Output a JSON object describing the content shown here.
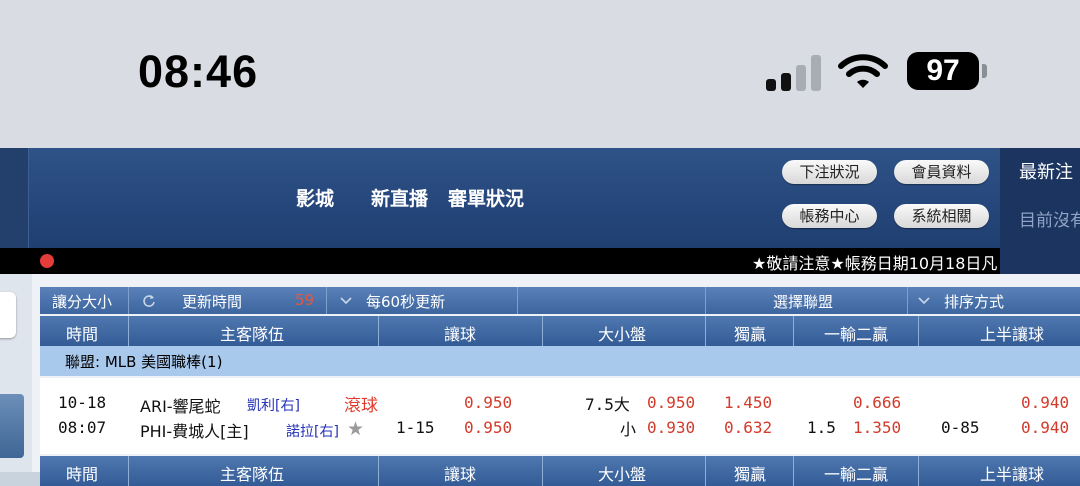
{
  "status_bar": {
    "time": "08:46",
    "battery": "97"
  },
  "header": {
    "nav": [
      "影城",
      "新直播",
      "審單狀況"
    ],
    "buttons": [
      "下注狀況",
      "會員資料",
      "帳務中心",
      "系統相關"
    ],
    "notice_title": "最新注",
    "notice_text": "目前沒有"
  },
  "ticker": {
    "text": "★敬請注意★帳務日期10月18日凡"
  },
  "toolbar": {
    "handicap_toggle": "讓分大小",
    "refresh_label": "更新時間",
    "countdown": "59",
    "refresh_interval": "每60秒更新",
    "select_league": "選擇聯盟",
    "sort_label": "排序方式"
  },
  "table": {
    "columns": [
      "時間",
      "主客隊伍",
      "讓球",
      "大小盤",
      "獨贏",
      "一輸二贏",
      "上半讓球"
    ],
    "league": "聯盟: MLB 美國職棒(1)",
    "match": {
      "date": "10-18",
      "time": "08:07",
      "team_away": "ARI-響尾蛇",
      "pitcher_away": "凱利[右]",
      "live_label": "滾球",
      "team_home": "PHI-費城人[主]",
      "pitcher_home": "諾拉[右]",
      "handicap_line": "1-15",
      "handicap_odds_away": "0.950",
      "handicap_odds_home": "0.950",
      "ou_over_line": "7.5大",
      "ou_over_odds": "0.950",
      "ou_under_label": "小",
      "ou_under_odds": "0.930",
      "moneyline_away": "1.450",
      "moneyline_home": "0.632",
      "one_lose_two_win_away": "0.666",
      "one_lose_two_win_line": "1.5",
      "one_lose_two_win_home": "1.350",
      "first_half_line": "0-85",
      "first_half_away": "0.940",
      "first_half_home": "0.940"
    }
  },
  "colors": {
    "header_blue": "#25467a",
    "table_header": "#3d659e",
    "league_row": "#a9c9ec",
    "odds_red": "#d23b2b",
    "pitcher_blue": "#2431b8"
  }
}
